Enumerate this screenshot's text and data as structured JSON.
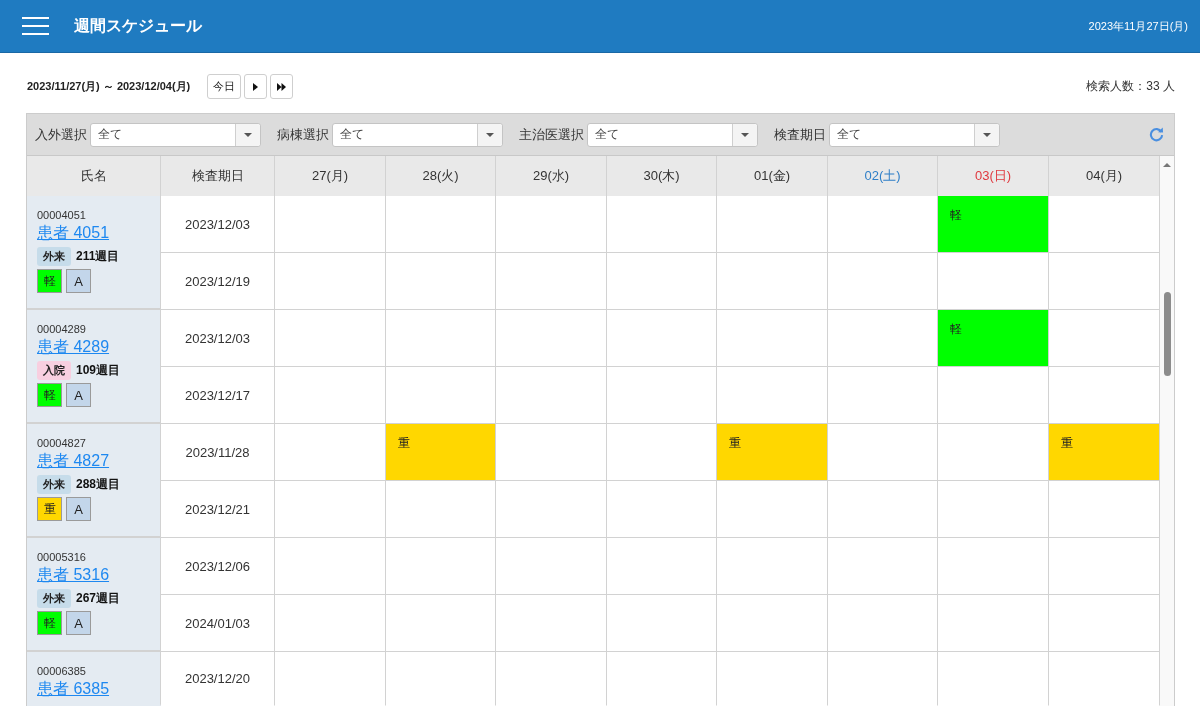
{
  "header": {
    "title": "週間スケジュール",
    "date": "2023年11月27日(月)"
  },
  "toolbar": {
    "range": "2023/11/27(月) ～ 2023/12/04(月)",
    "today_button": "今日",
    "count": "検索人数：33 人"
  },
  "filters": [
    {
      "label": "入外選択",
      "value": "全て"
    },
    {
      "label": "病棟選択",
      "value": "全て"
    },
    {
      "label": "主治医選択",
      "value": "全て"
    },
    {
      "label": "検査期日",
      "value": "全て"
    }
  ],
  "table": {
    "columns": [
      {
        "label": "氏名"
      },
      {
        "label": "検査期日"
      }
    ],
    "days": [
      {
        "label": "27(月)",
        "kind": "weekday"
      },
      {
        "label": "28(火)",
        "kind": "weekday"
      },
      {
        "label": "29(水)",
        "kind": "weekday"
      },
      {
        "label": "30(木)",
        "kind": "weekday"
      },
      {
        "label": "01(金)",
        "kind": "weekday"
      },
      {
        "label": "02(土)",
        "kind": "saturday"
      },
      {
        "label": "03(日)",
        "kind": "sunday"
      },
      {
        "label": "04(月)",
        "kind": "weekday"
      }
    ],
    "patients": [
      {
        "id": "00004051",
        "name": "患者 4051",
        "status": {
          "label": "外来",
          "kind": "outpatient"
        },
        "weeks": "211週目",
        "severity": {
          "label": "軽",
          "color": "#00ff00"
        },
        "grade": "A",
        "rows": [
          {
            "date": "2023/12/03",
            "cells": [
              null,
              null,
              null,
              null,
              null,
              null,
              {
                "label": "軽",
                "color": "#00ff00"
              },
              null
            ]
          },
          {
            "date": "2023/12/19",
            "cells": [
              null,
              null,
              null,
              null,
              null,
              null,
              null,
              null
            ]
          }
        ]
      },
      {
        "id": "00004289",
        "name": "患者 4289",
        "status": {
          "label": "入院",
          "kind": "inpatient"
        },
        "weeks": "109週目",
        "severity": {
          "label": "軽",
          "color": "#00ff00"
        },
        "grade": "A",
        "rows": [
          {
            "date": "2023/12/03",
            "cells": [
              null,
              null,
              null,
              null,
              null,
              null,
              {
                "label": "軽",
                "color": "#00ff00"
              },
              null
            ]
          },
          {
            "date": "2023/12/17",
            "cells": [
              null,
              null,
              null,
              null,
              null,
              null,
              null,
              null
            ]
          }
        ]
      },
      {
        "id": "00004827",
        "name": "患者 4827",
        "status": {
          "label": "外来",
          "kind": "outpatient"
        },
        "weeks": "288週目",
        "severity": {
          "label": "重",
          "color": "#ffd700"
        },
        "grade": "A",
        "rows": [
          {
            "date": "2023/11/28",
            "cells": [
              null,
              {
                "label": "重",
                "color": "#ffd700"
              },
              null,
              null,
              {
                "label": "重",
                "color": "#ffd700"
              },
              null,
              null,
              {
                "label": "重",
                "color": "#ffd700"
              }
            ]
          },
          {
            "date": "2023/12/21",
            "cells": [
              null,
              null,
              null,
              null,
              null,
              null,
              null,
              null
            ]
          }
        ]
      },
      {
        "id": "00005316",
        "name": "患者 5316",
        "status": {
          "label": "外来",
          "kind": "outpatient"
        },
        "weeks": "267週目",
        "severity": {
          "label": "軽",
          "color": "#00ff00"
        },
        "grade": "A",
        "rows": [
          {
            "date": "2023/12/06",
            "cells": [
              null,
              null,
              null,
              null,
              null,
              null,
              null,
              null
            ]
          },
          {
            "date": "2024/01/03",
            "cells": [
              null,
              null,
              null,
              null,
              null,
              null,
              null,
              null
            ]
          }
        ]
      },
      {
        "id": "00006385",
        "name": "患者 6385",
        "rows": [
          {
            "date": "2023/12/20",
            "cells": [
              null,
              null,
              null,
              null,
              null,
              null,
              null,
              null
            ]
          }
        ]
      }
    ]
  }
}
